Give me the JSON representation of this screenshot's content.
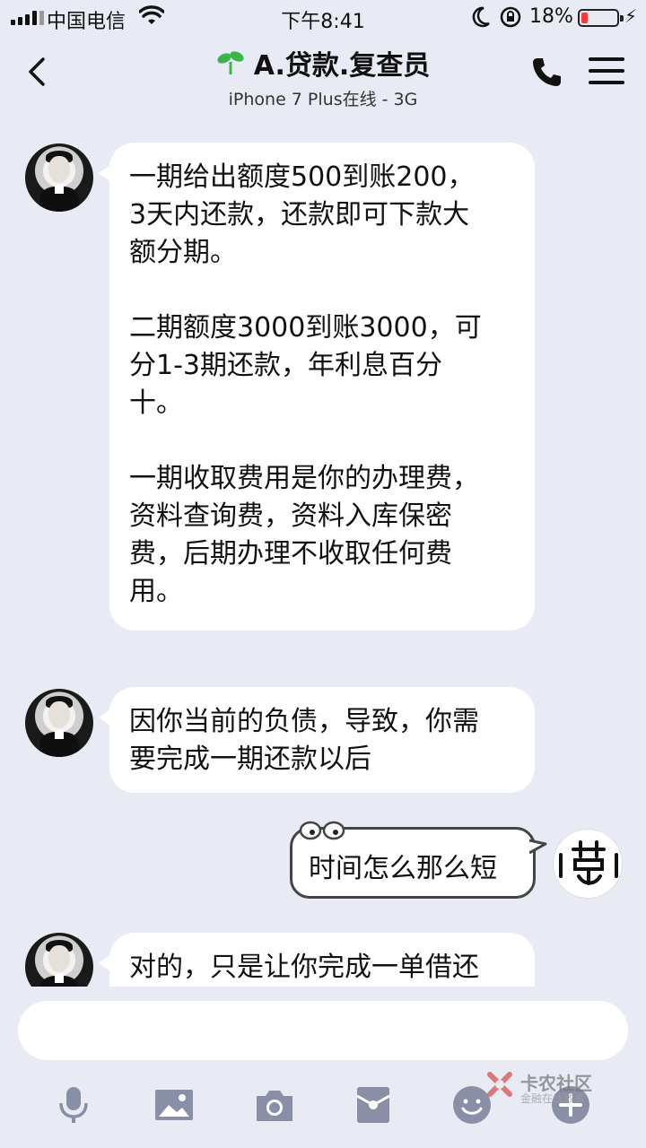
{
  "status_bar": {
    "carrier": "中国电信",
    "time": "下午8:41",
    "battery_percent": "18%",
    "battery_level": 0.18
  },
  "header": {
    "back_icon": "chevron-left-icon",
    "title": "A.贷款.复查员",
    "subtitle": "iPhone 7 Plus在线 - 3G",
    "phone_icon": "phone-icon",
    "menu_icon": "hamburger-menu-icon"
  },
  "messages": [
    {
      "side": "left",
      "text": "一期给出额度500到账200，\n3天内还款，还款即可下款大\n额分期。\n\n二期额度3000到账3000，可\n分1-3期还款，年利息百分\n十。\n\n一期收取费用是你的办理费，\n资料查询费，资料入库保密\n费，后期办理不收取任何费\n用。"
    },
    {
      "side": "left",
      "text": "因你当前的负债，导致，你需\n要完成一期还款以后"
    },
    {
      "side": "right",
      "text": "时间怎么那么短"
    },
    {
      "side": "left",
      "text": "对的，只是让你完成一单借还"
    }
  ],
  "input": {
    "placeholder": ""
  },
  "toolbar": {
    "icons": [
      "microphone-icon",
      "image-icon",
      "camera-icon",
      "red-packet-icon",
      "emoji-icon",
      "plus-icon"
    ]
  },
  "watermark": {
    "title": "卡农社区",
    "subtitle": "金融在线教育"
  },
  "colors": {
    "background": "#e9ebf4",
    "bubble": "#ffffff",
    "battery_low": "#f23b3b",
    "sprout_green": "#3bb54a"
  }
}
